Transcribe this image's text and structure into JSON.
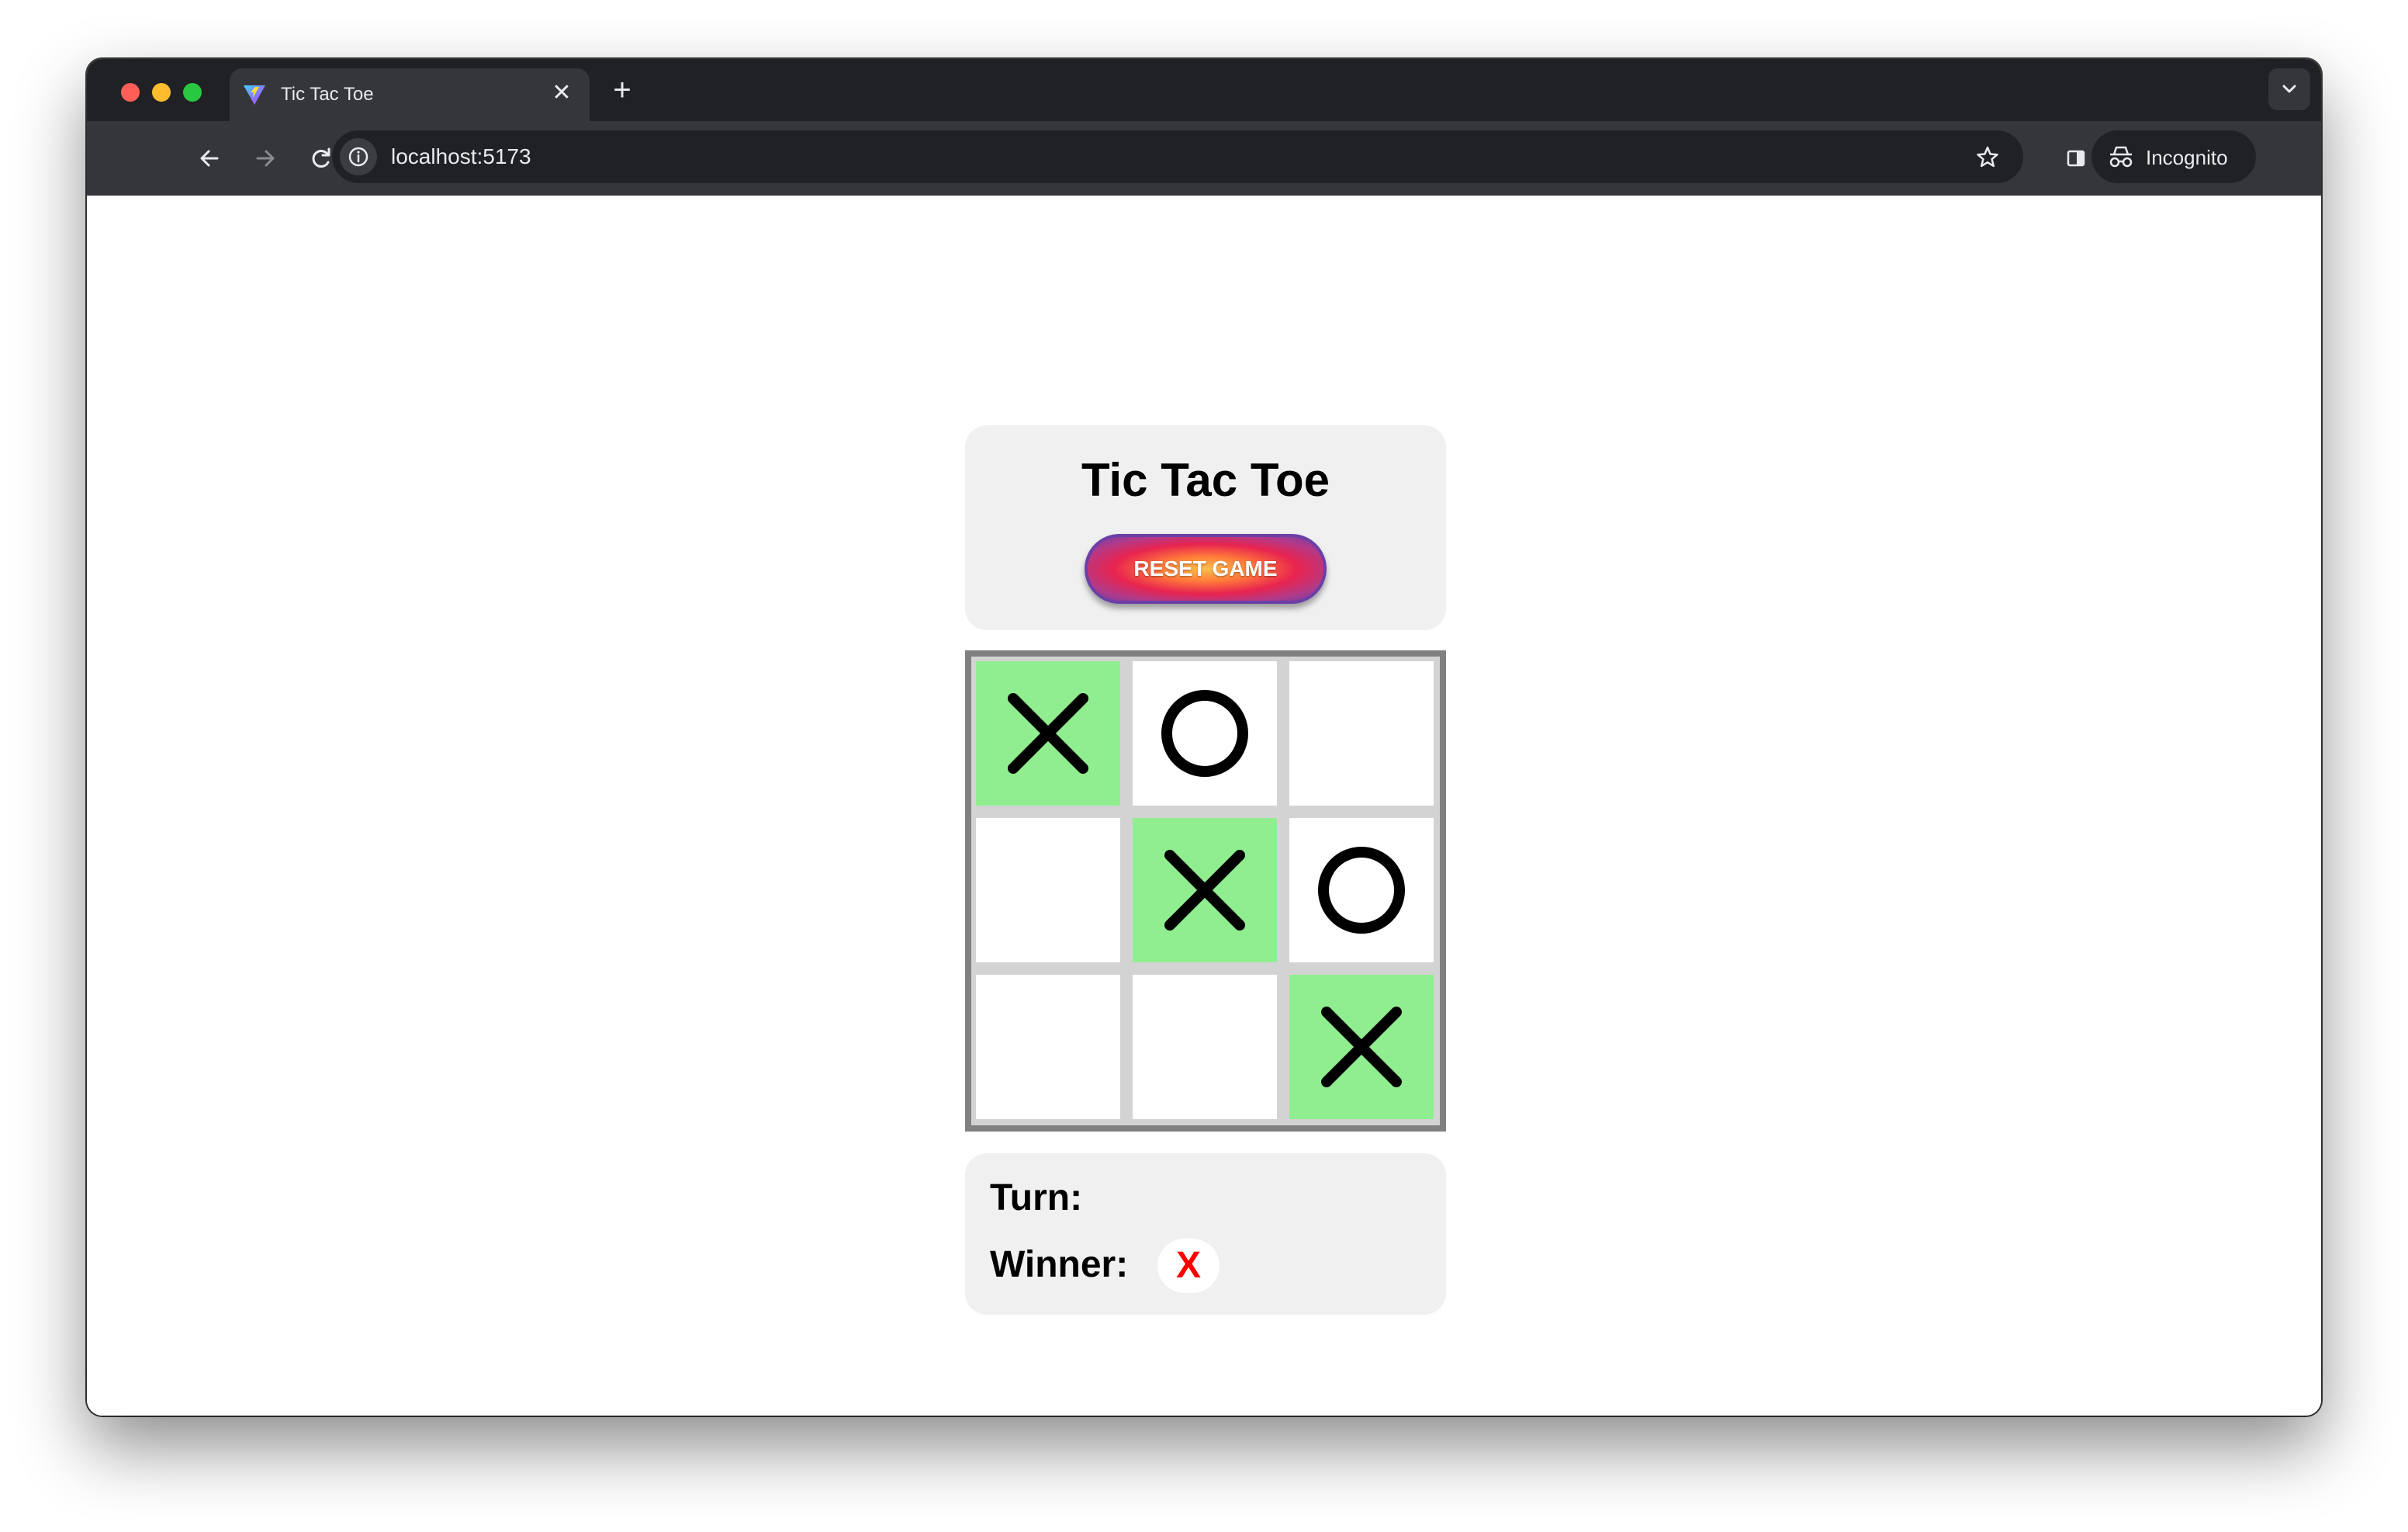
{
  "browser": {
    "tab_title": "Tic Tac Toe",
    "tab_close": "✕",
    "new_tab": "+",
    "url": "localhost:5173",
    "profile_label": "Incognito"
  },
  "game": {
    "title": "Tic Tac Toe",
    "reset_label": "RESET GAME",
    "board": [
      {
        "mark": "X",
        "winning": true
      },
      {
        "mark": "O",
        "winning": false
      },
      {
        "mark": "",
        "winning": false
      },
      {
        "mark": "",
        "winning": false
      },
      {
        "mark": "X",
        "winning": true
      },
      {
        "mark": "O",
        "winning": false
      },
      {
        "mark": "",
        "winning": false
      },
      {
        "mark": "",
        "winning": false
      },
      {
        "mark": "X",
        "winning": true
      }
    ],
    "turn_label": "Turn:",
    "turn_value": "",
    "winner_label": "Winner:",
    "winner_value": "X"
  },
  "colors": {
    "winning_cell": "#90ee90",
    "winner_text": "#ff0000",
    "board_border": "#808080"
  }
}
